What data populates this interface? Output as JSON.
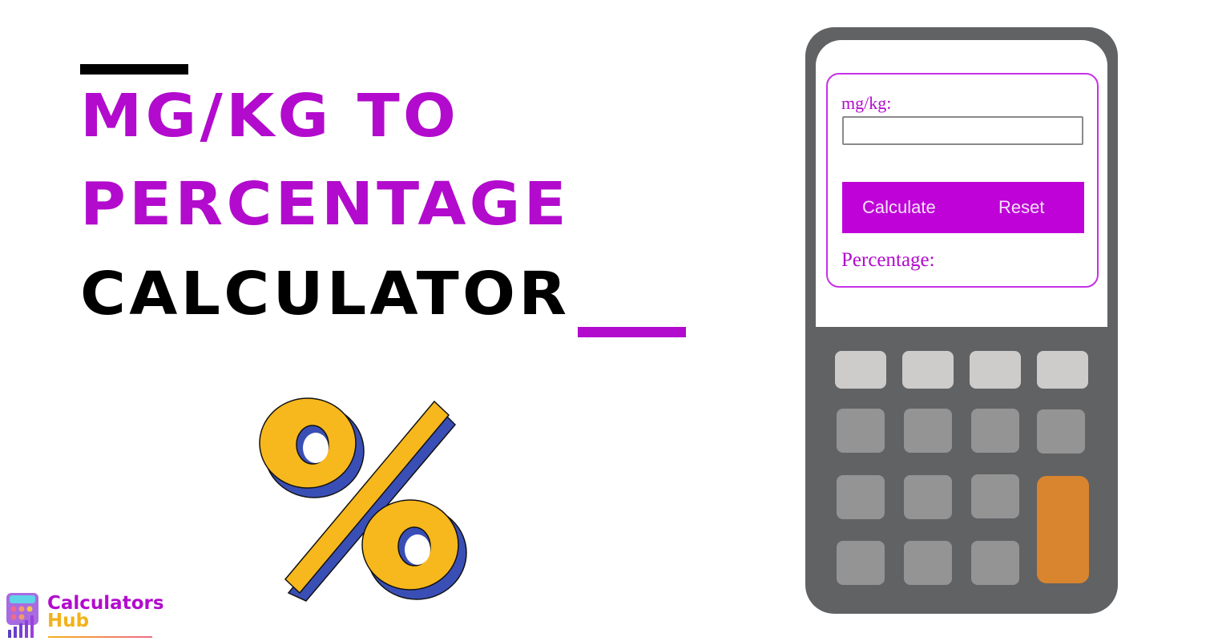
{
  "headline": {
    "line1": "MG/KG TO",
    "line2": "PERCENTAGE",
    "line3": "CALCULATOR"
  },
  "calculator_widget": {
    "input_label": "mg/kg:",
    "input_value": "",
    "input_placeholder": "",
    "buttons": {
      "calculate": "Calculate",
      "reset": "Reset"
    },
    "result_label": "Percentage:"
  },
  "logo": {
    "line1": "Calculators",
    "line2": "Hub"
  },
  "colors": {
    "accent_purple": "#b20bcd",
    "button_purple": "#bf02d8",
    "calculator_body": "#616264",
    "key_orange": "#d98530",
    "percent_yellow": "#f7b81d",
    "percent_shadow_blue": "#3a4fb5"
  },
  "icons": {
    "percent_graphic": "percent-sign-3d",
    "calculator_graphic": "calculator-device",
    "logo_icon": "calculator-bar-chart-icon"
  }
}
